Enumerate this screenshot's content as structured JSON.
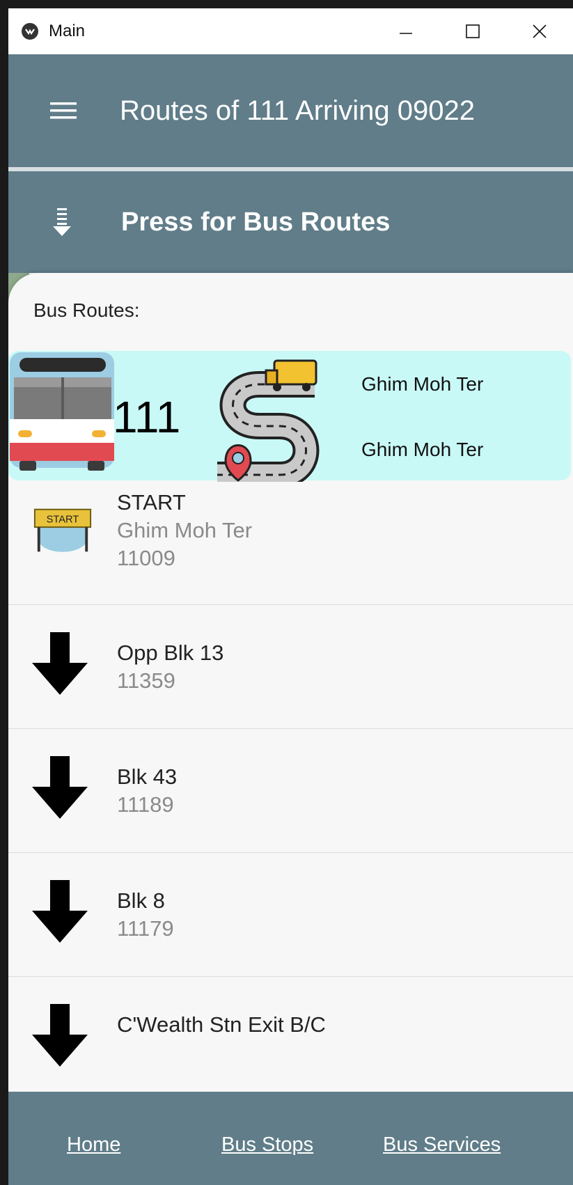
{
  "window": {
    "title": "Main"
  },
  "appbar": {
    "title": "Routes of 111 Arriving 09022"
  },
  "routes_bar": {
    "label": "Press for Bus Routes"
  },
  "sheet": {
    "label": "Bus Routes:"
  },
  "service": {
    "number": "111",
    "destination_1": "Ghim Moh Ter",
    "destination_2": "Ghim Moh Ter"
  },
  "stops": [
    {
      "name": "START",
      "road": "Ghim Moh Ter",
      "code": "11009",
      "icon": "start-sign-icon"
    },
    {
      "name": "Opp Blk 13",
      "code": "11359",
      "icon": "arrow-down-icon"
    },
    {
      "name": "Blk 43",
      "code": "11189",
      "icon": "arrow-down-icon"
    },
    {
      "name": "Blk 8",
      "code": "11179",
      "icon": "arrow-down-icon"
    },
    {
      "name": "C'Wealth Stn Exit B/C",
      "code": "",
      "icon": "arrow-down-icon"
    }
  ],
  "nav": {
    "home": "Home",
    "bus_stops": "Bus Stops",
    "bus_services": "Bus Services"
  },
  "colors": {
    "appbar": "#607d89",
    "card": "#c9f9f6",
    "background": "#f7f7f7"
  }
}
